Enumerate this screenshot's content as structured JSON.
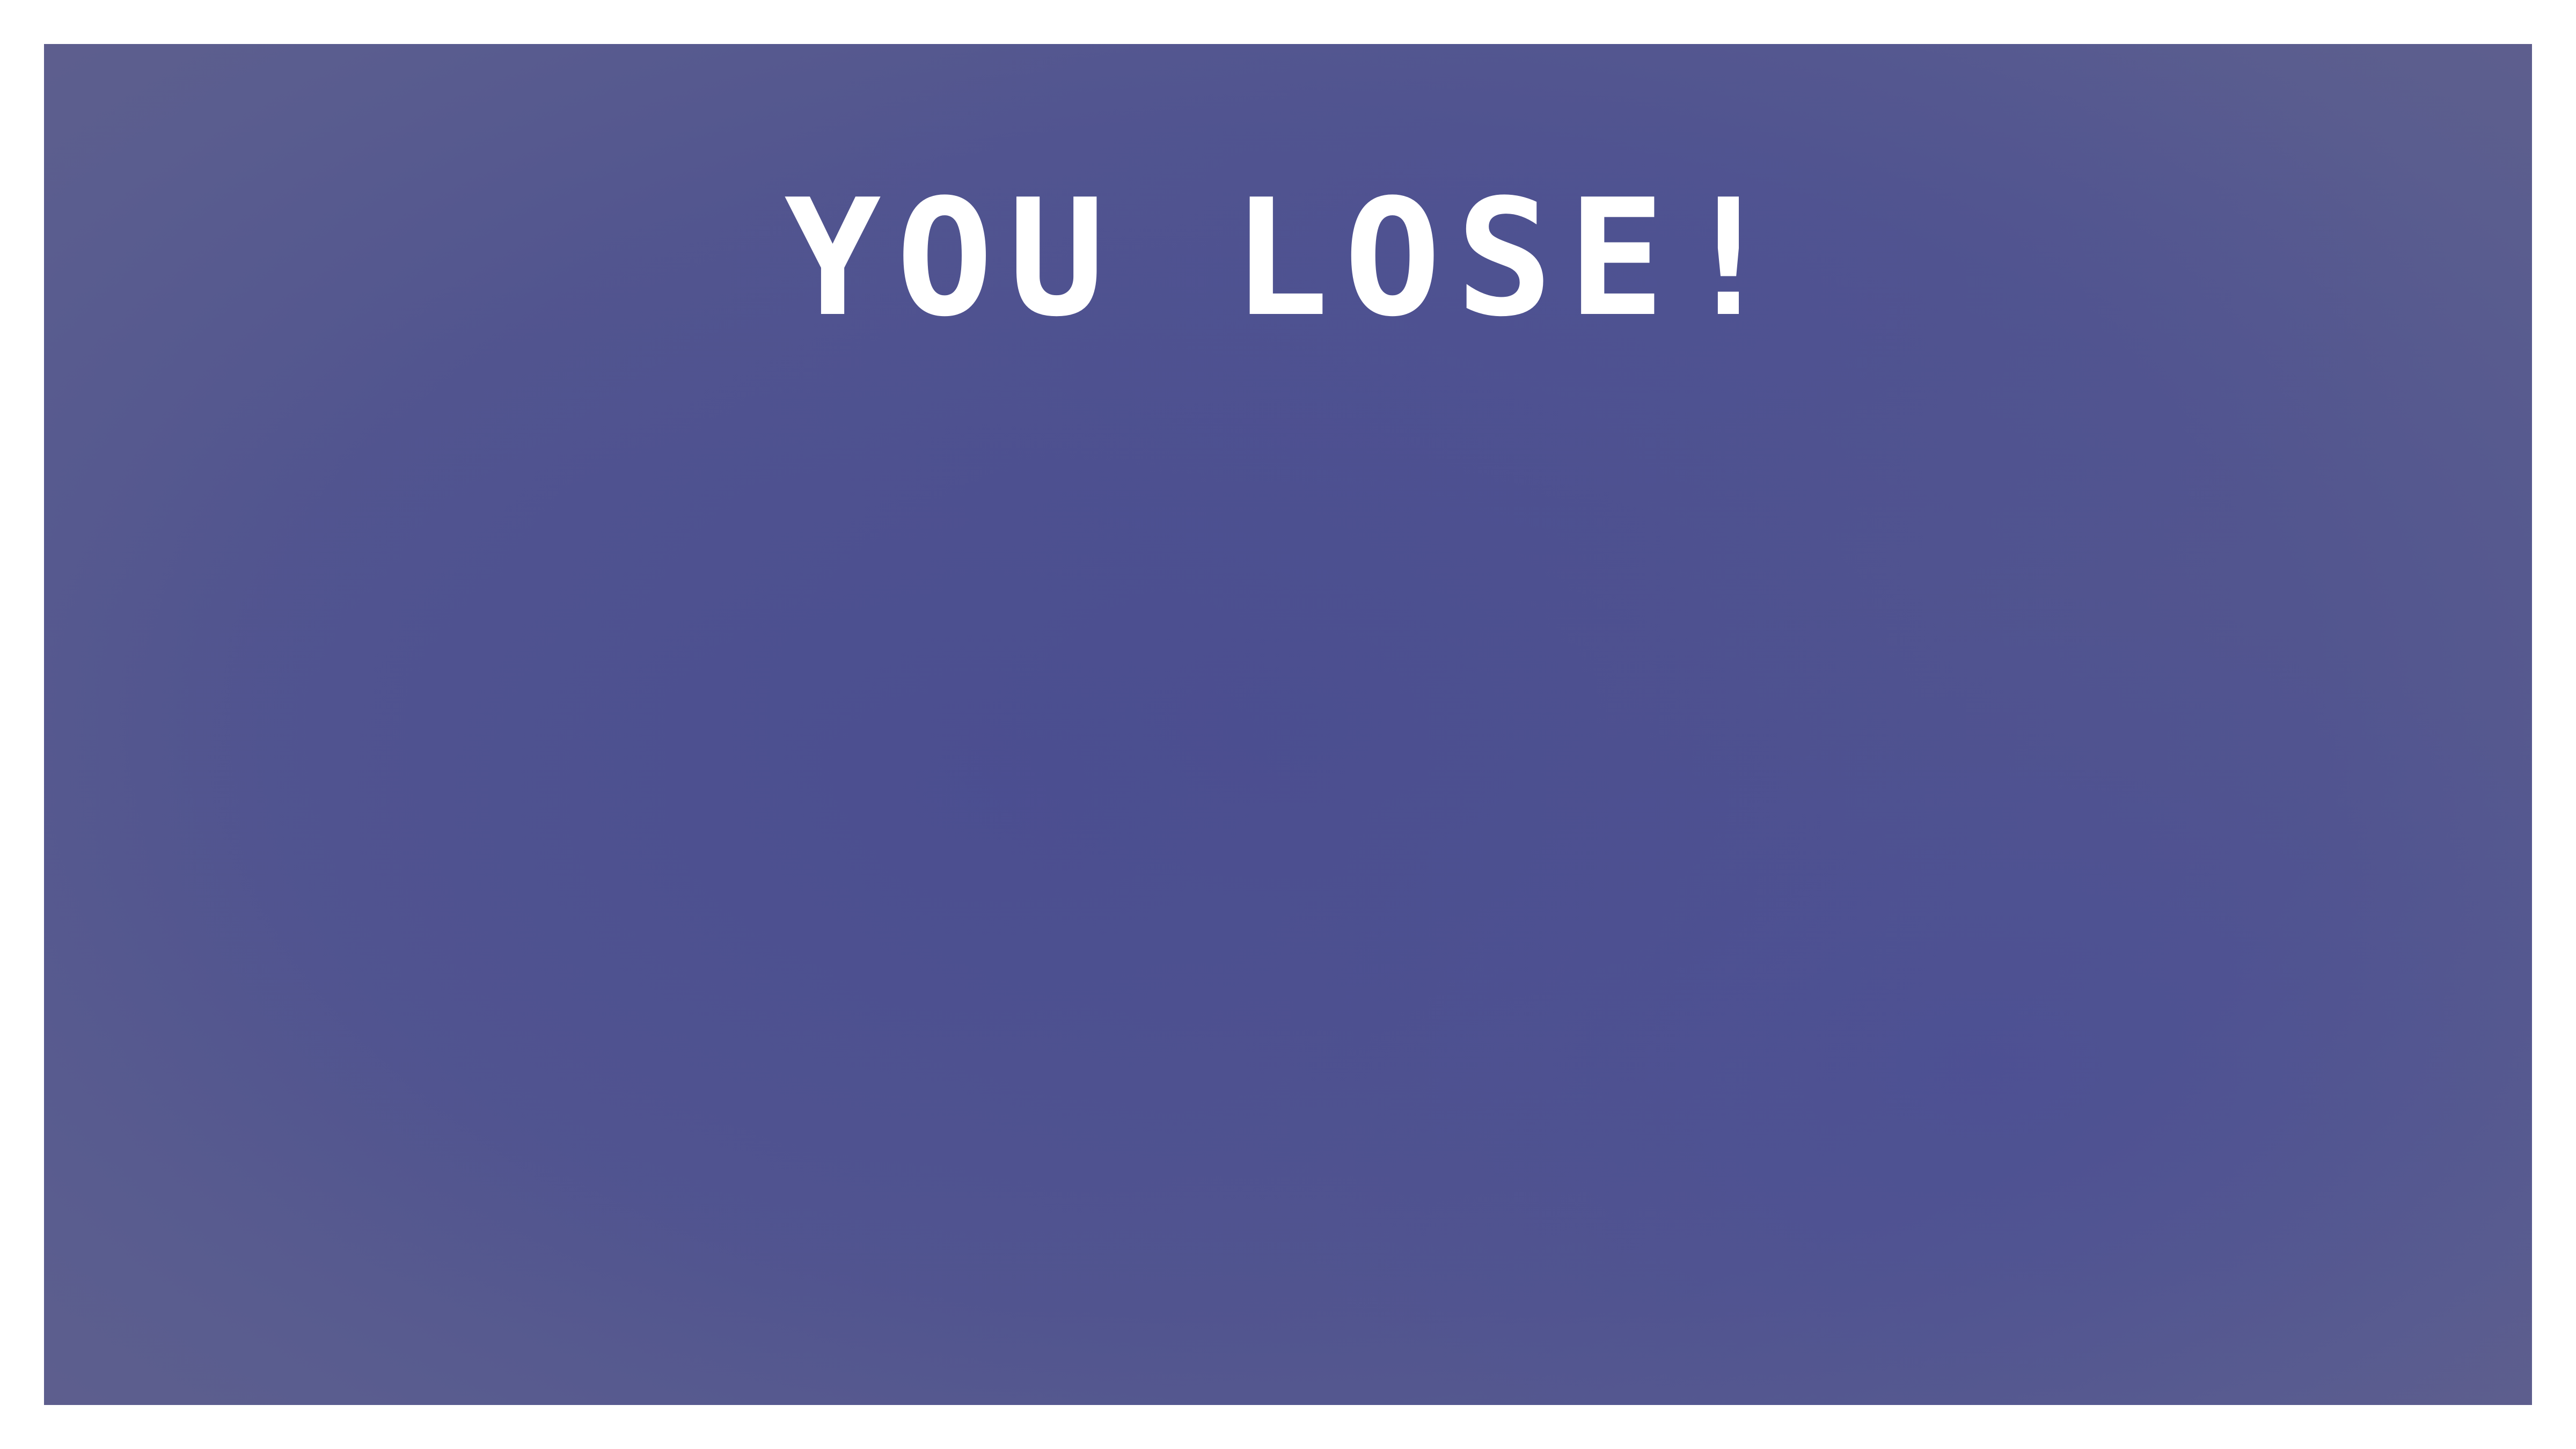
{
  "game": {
    "end_message": "YOU LOSE!"
  },
  "colors": {
    "page_background": "#ffffff",
    "screen_background": "#4d508f",
    "title_text": "#ffffff"
  }
}
